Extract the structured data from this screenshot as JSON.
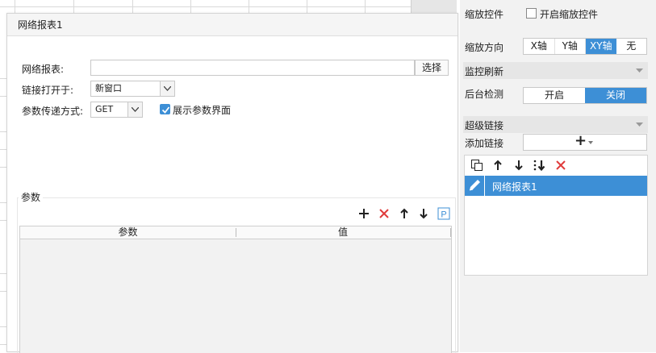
{
  "dialog": {
    "title": "网络报表1",
    "report_label": "网络报表:",
    "report_value": "",
    "select_button": "选择",
    "open_in_label": "链接打开于:",
    "open_in_value": "新窗口",
    "method_label": "参数传递方式:",
    "method_value": "GET",
    "show_params_label": "展示参数界面",
    "show_params_checked": true,
    "params_group_title": "参数",
    "params_table": {
      "columns": [
        "参数",
        "值"
      ],
      "rows": []
    },
    "params_toolbar": [
      "add-icon",
      "delete-icon",
      "arrow-up-icon",
      "arrow-down-icon",
      "param-p-icon"
    ]
  },
  "panel": {
    "zoom_control_label": "缩放控件",
    "enable_zoom_label": "开启缩放控件",
    "enable_zoom_checked": false,
    "zoom_direction_label": "缩放方向",
    "zoom_direction_options": [
      "X轴",
      "Y轴",
      "XY轴",
      "无"
    ],
    "zoom_direction_selected": "XY轴",
    "monitor_refresh_title": "监控刷新",
    "background_check_label": "后台检测",
    "background_check_options": [
      "开启",
      "关闭"
    ],
    "background_check_selected": "关闭",
    "hyperlink_title": "超级链接",
    "add_link_label": "添加链接",
    "add_link_button": "+",
    "link_toolbar": [
      "copy-icon",
      "arrow-up-icon",
      "arrow-down-icon",
      "sort-icon",
      "delete-icon"
    ],
    "links": [
      "网络报表1"
    ]
  },
  "colors": {
    "accent": "#3d8fd6",
    "delete": "#e03b3b",
    "panel_bg": "#f2f2f2"
  }
}
